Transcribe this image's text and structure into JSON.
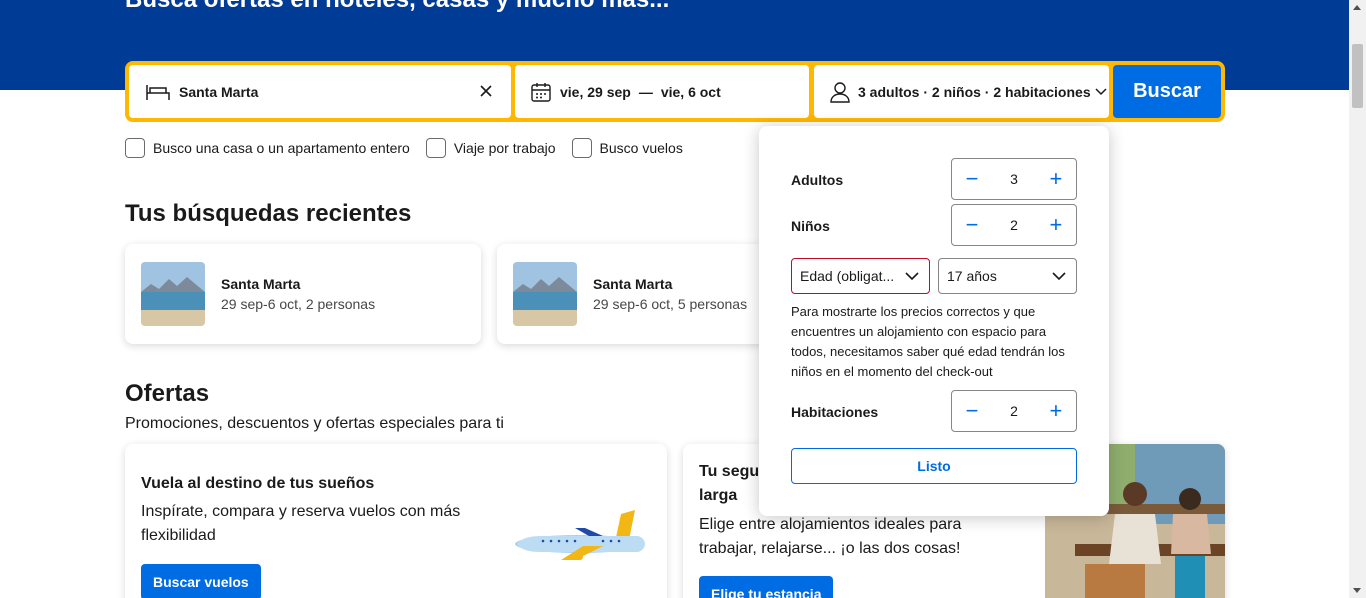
{
  "hero": {
    "title": "Busca ofertas en hoteles, casas y mucho más..."
  },
  "search": {
    "destination_value": "Santa Marta",
    "checkin": "vie, 29 sep",
    "separator": "—",
    "checkout": "vie, 6 oct",
    "occupancy": "3 adultos · 2 niños · 2 habitaciones",
    "submit_label": "Buscar"
  },
  "checkboxes": [
    {
      "label": "Busco una casa o un apartamento entero"
    },
    {
      "label": "Viaje por trabajo"
    },
    {
      "label": "Busco vuelos"
    }
  ],
  "recent": {
    "title": "Tus búsquedas recientes",
    "items": [
      {
        "title": "Santa Marta",
        "subtitle": "29 sep-6 oct, 2 personas"
      },
      {
        "title": "Santa Marta",
        "subtitle": "29 sep-6 oct, 5 personas"
      }
    ]
  },
  "offers": {
    "title": "Ofertas",
    "subtitle": "Promociones, descuentos y ofertas especiales para ti",
    "cards": [
      {
        "title": "Vuela al destino de tus sueños",
        "description": "Inspírate, compara y reserva vuelos con más flexibilidad",
        "button": "Buscar vuelos"
      },
      {
        "title": "Tu segur",
        "title_line2": "larga",
        "description": "Elige entre alojamientos ideales para trabajar, relajarse... ¡o las dos cosas!",
        "button": "Elige tu estancia"
      }
    ]
  },
  "occupancy_popup": {
    "adults_label": "Adultos",
    "adults_value": "3",
    "children_label": "Niños",
    "children_value": "2",
    "child_age_1": "Edad (obligat...",
    "child_age_2": "17 años",
    "note": "Para mostrarte los precios correctos y que encuentres un alojamiento con espacio para todos, necesitamos saber qué edad tendrán los niños en el momento del check-out",
    "rooms_label": "Habitaciones",
    "rooms_value": "2",
    "done_label": "Listo",
    "minus": "−",
    "plus": "+"
  },
  "colors": {
    "brand": "#003b95",
    "accent": "#ffb700",
    "primary": "#006ce4",
    "error": "#c00a27"
  },
  "icons": [
    "bed-icon",
    "clear-icon",
    "calendar-icon",
    "person-icon",
    "chevron-down-icon",
    "airplane-icon"
  ]
}
